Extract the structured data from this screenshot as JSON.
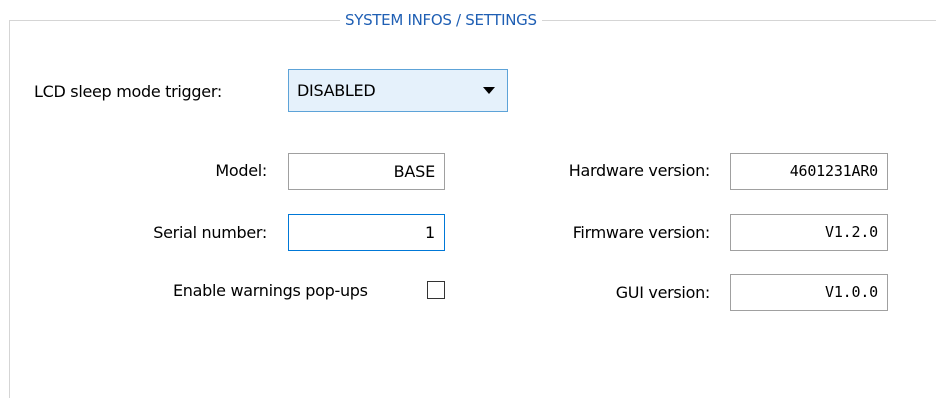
{
  "group": {
    "title": "SYSTEM INFOS / SETTINGS"
  },
  "lcd_sleep": {
    "label": "LCD sleep mode trigger:",
    "selected": "DISABLED"
  },
  "model": {
    "label": "Model:",
    "value": "BASE"
  },
  "serial_number": {
    "label": "Serial number:",
    "value": "1"
  },
  "warnings": {
    "label": "Enable warnings pop-ups",
    "checked": false
  },
  "hardware_version": {
    "label": "Hardware version:",
    "value": "4601231AR0"
  },
  "firmware_version": {
    "label": "Firmware version:",
    "value": "V1.2.0"
  },
  "gui_version": {
    "label": "GUI version:",
    "value": "V1.0.0"
  },
  "colors": {
    "title": "#1f5fb4",
    "combo_background": "#e5f1fb",
    "combo_border": "#5da3d8",
    "focus_border": "#0078d7",
    "field_border": "#a0a0a0",
    "frame_border": "#d5d5d5"
  },
  "icons": {
    "combo_arrow": "chevron-down-icon"
  }
}
